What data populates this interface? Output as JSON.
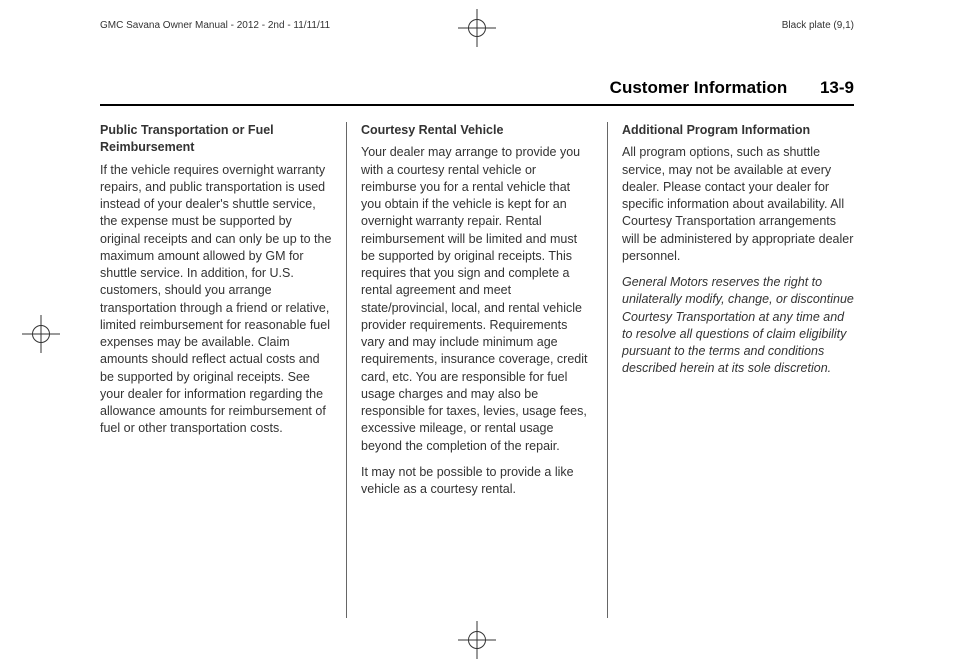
{
  "top_header": {
    "left": "GMC Savana Owner Manual - 2012 - 2nd - 11/11/11",
    "right": "Black plate (9,1)"
  },
  "page_header": {
    "title": "Customer Information",
    "page_number": "13-9"
  },
  "columns": {
    "col1": {
      "heading": "Public Transportation or Fuel Reimbursement",
      "para1": "If the vehicle requires overnight warranty repairs, and public transportation is used instead of your dealer's shuttle service, the expense must be supported by original receipts and can only be up to the maximum amount allowed by GM for shuttle service. In addition, for U.S. customers, should you arrange transportation through a friend or relative, limited reimbursement for reasonable fuel expenses may be available. Claim amounts should reflect actual costs and be supported by original receipts. See your dealer for information regarding the allowance amounts for reimbursement of fuel or other transportation costs."
    },
    "col2": {
      "heading": "Courtesy Rental Vehicle",
      "para1": "Your dealer may arrange to provide you with a courtesy rental vehicle or reimburse you for a rental vehicle that you obtain if the vehicle is kept for an overnight warranty repair. Rental reimbursement will be limited and must be supported by original receipts. This requires that you sign and complete a rental agreement and meet state/provincial, local, and rental vehicle provider requirements. Requirements vary and may include minimum age requirements, insurance coverage, credit card, etc. You are responsible for fuel usage charges and may also be responsible for taxes, levies, usage fees, excessive mileage, or rental usage beyond the completion of the repair.",
      "para2": "It may not be possible to provide a like vehicle as a courtesy rental."
    },
    "col3": {
      "heading": "Additional Program Information",
      "para1": "All program options, such as shuttle service, may not be available at every dealer. Please contact your dealer for specific information about availability. All Courtesy Transportation arrangements will be administered by appropriate dealer personnel.",
      "para2": "General Motors reserves the right to unilaterally modify, change, or discontinue Courtesy Transportation at any time and to resolve all questions of claim eligibility pursuant to the terms and conditions described herein at its sole discretion."
    }
  }
}
